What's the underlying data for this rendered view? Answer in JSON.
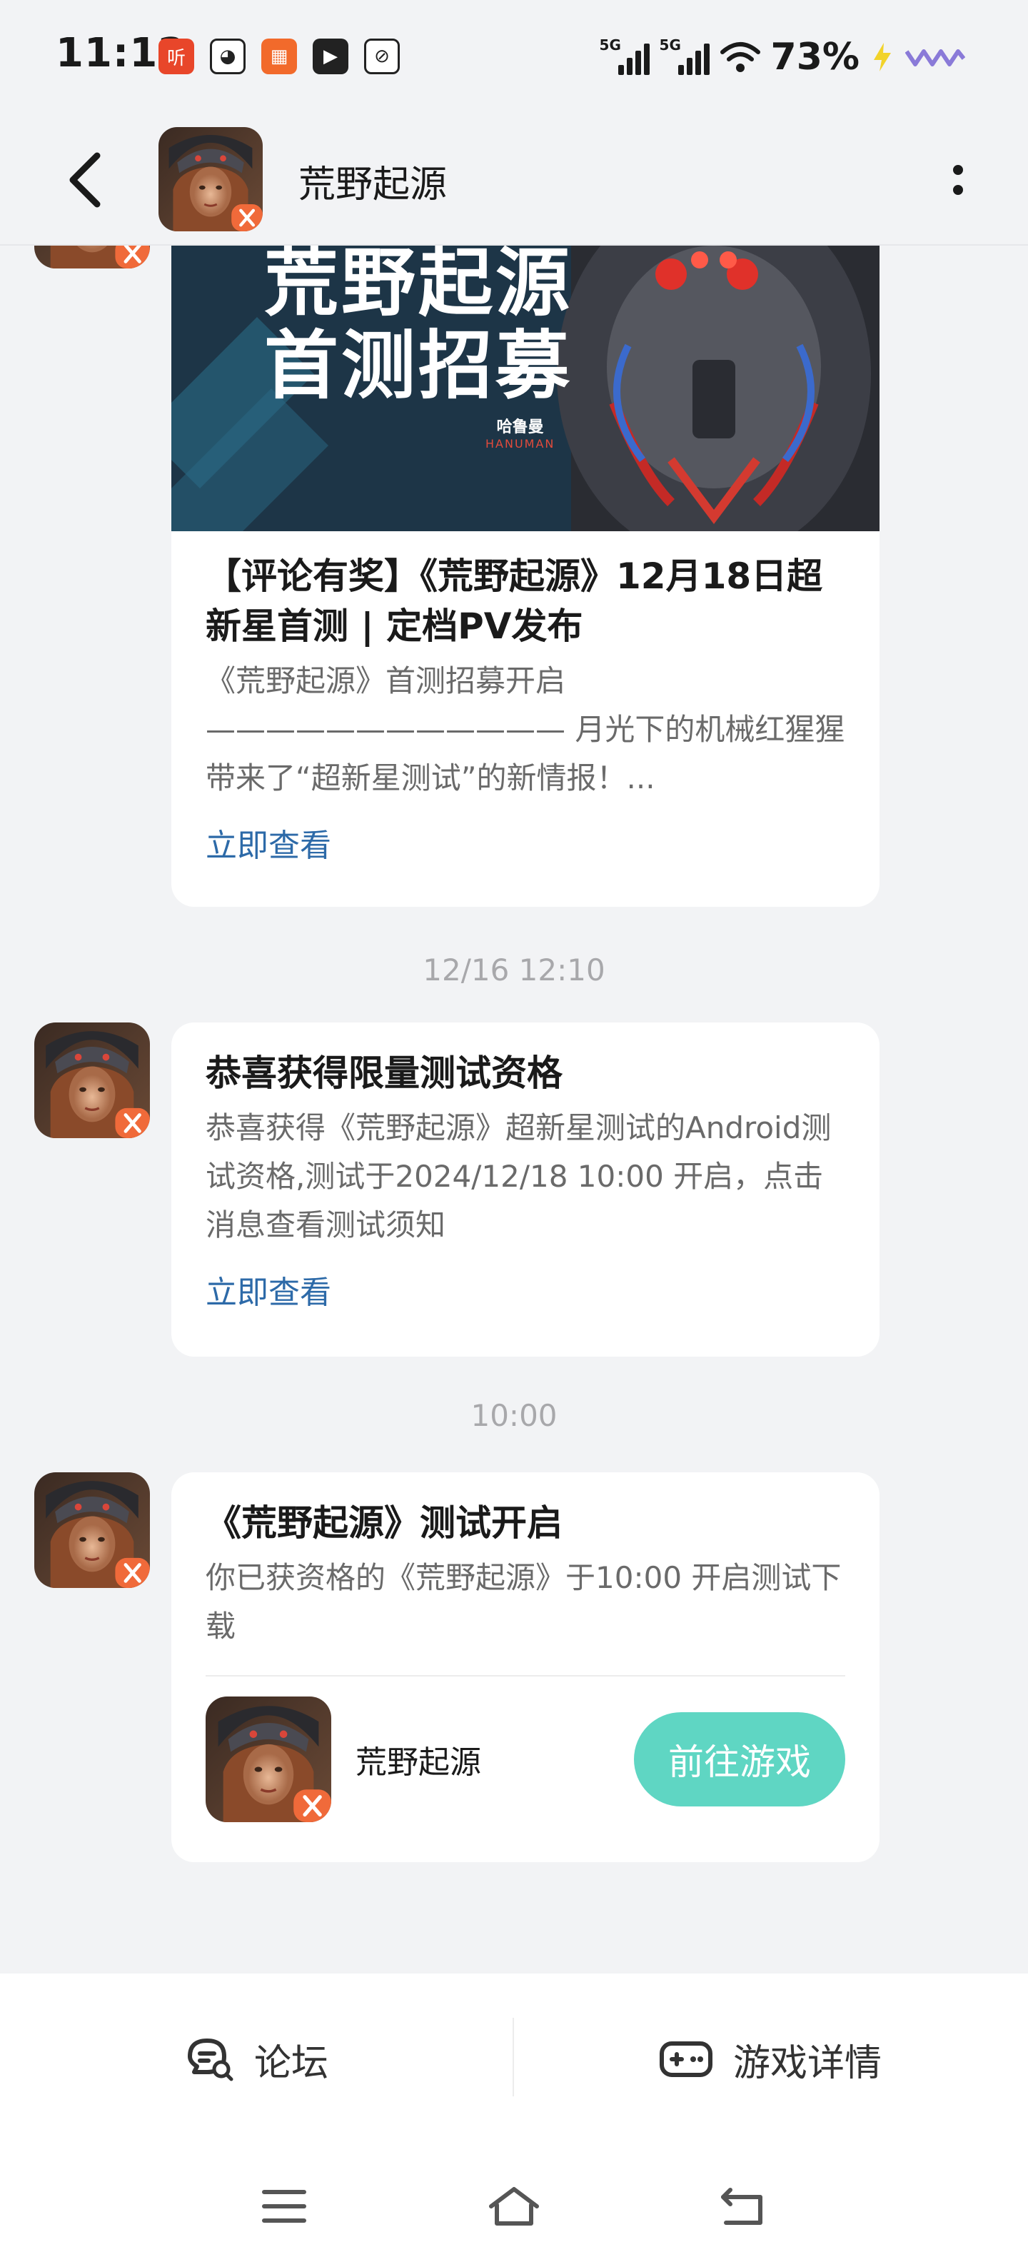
{
  "status_bar": {
    "time": "11:12",
    "app_icons": [
      "listen-app-icon",
      "cat-app-icon",
      "grid-app-icon",
      "play-app-icon",
      "leaf-app-icon"
    ],
    "signal_1_tag": "5G",
    "signal_2_tag": "5G",
    "battery": "73%"
  },
  "header": {
    "title": "荒野起源"
  },
  "messages": [
    {
      "banner_line1": "荒野起源",
      "banner_line2": "首测招募",
      "banner_brand_cn": "哈鲁曼",
      "banner_brand_en": "HANUMAN",
      "title": "【评论有奖】《荒野起源》12月18日超新星首测 | 定档PV发布",
      "body": "《荒野起源》首测招募开启 ———————————— 月光下的机械红猩猩带来了“超新星测试”的新情报！...",
      "link": "立即查看"
    },
    {
      "timestamp": "12/16  12:10",
      "title": "恭喜获得限量测试资格",
      "body": "恭喜获得《荒野起源》超新星测试的Android测试资格,测试于2024/12/18 10:00 开启，点击消息查看测试须知",
      "link": "立即查看"
    },
    {
      "timestamp": "10:00",
      "title": "《荒野起源》测试开启",
      "body": "你已获资格的《荒野起源》于10:00 开启测试下载",
      "game_name": "荒野起源",
      "button": "前往游戏"
    }
  ],
  "bottom_bar": {
    "forum_label": "论坛",
    "game_detail_label": "游戏详情"
  },
  "colors": {
    "accent_link": "#2d6aa8",
    "play_button": "#5fd6c3",
    "background": "#f2f3f5"
  }
}
